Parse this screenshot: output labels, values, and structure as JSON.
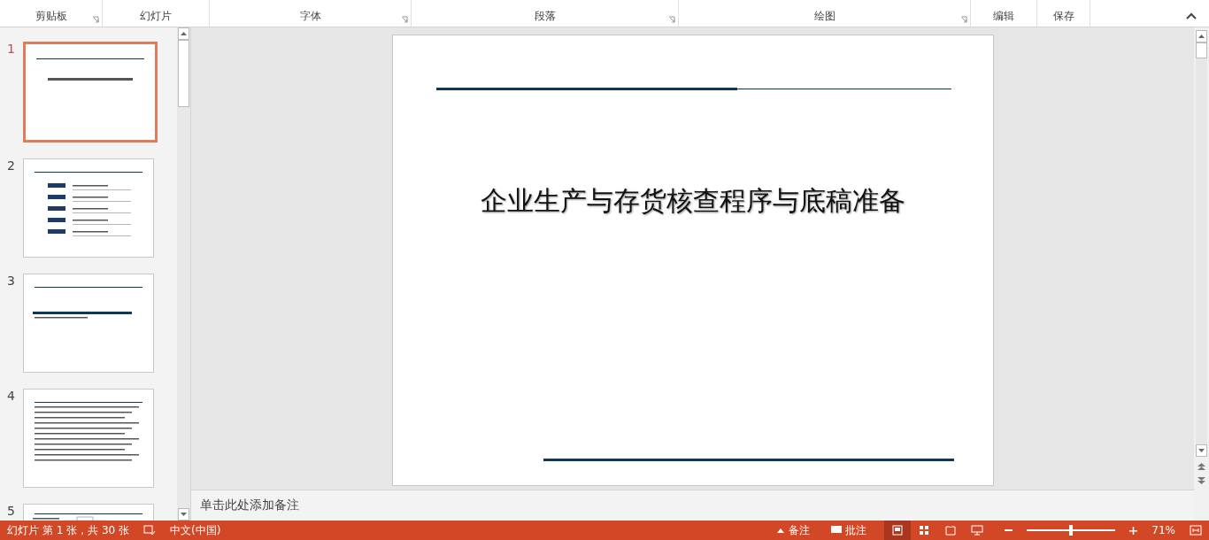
{
  "ribbon_groups": [
    {
      "label": "剪贴板",
      "launcher": true
    },
    {
      "label": "幻灯片",
      "launcher": false
    },
    {
      "label": "字体",
      "launcher": true
    },
    {
      "label": "段落",
      "launcher": true
    },
    {
      "label": "绘图",
      "launcher": true
    },
    {
      "label": "编辑",
      "launcher": false
    },
    {
      "label": "保存",
      "launcher": false
    }
  ],
  "slides": [
    {
      "number": "1",
      "selected": true,
      "kind": "title"
    },
    {
      "number": "2",
      "selected": false,
      "kind": "agenda"
    },
    {
      "number": "3",
      "selected": false,
      "kind": "section"
    },
    {
      "number": "4",
      "selected": false,
      "kind": "text"
    },
    {
      "number": "5",
      "selected": false,
      "kind": "diagram"
    }
  ],
  "current_slide": {
    "title": "企业生产与存货核查程序与底稿准备"
  },
  "notes": {
    "placeholder": "单击此处添加备注"
  },
  "status_bar": {
    "slide_info": "幻灯片 第 1 张，共 30 张",
    "language": "中文(中国)",
    "notes_button": "备注",
    "comments_button": "批注",
    "views": [
      {
        "kind": "normal",
        "selected": true
      },
      {
        "kind": "sorter",
        "selected": false
      },
      {
        "kind": "reading",
        "selected": false
      },
      {
        "kind": "show",
        "selected": false
      }
    ],
    "zoom": {
      "level": 0.5,
      "reading": "71%"
    }
  }
}
